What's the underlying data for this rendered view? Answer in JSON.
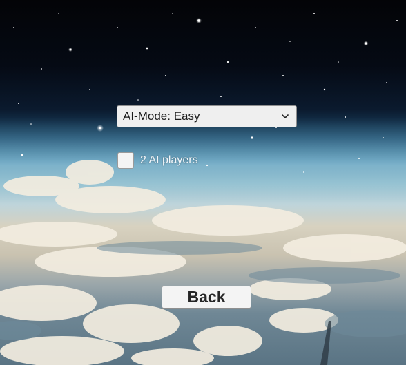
{
  "ai_mode": {
    "selected_value": "AI-Mode: Easy",
    "icon": "chevron-down-icon"
  },
  "ai_players": {
    "label": "2 AI players",
    "checked": false
  },
  "back_button": {
    "label": "Back"
  },
  "colors": {
    "control_bg": "#efefef",
    "control_border": "#8f8f8f",
    "label_text": "#f2f6fa",
    "button_text": "#262626"
  }
}
